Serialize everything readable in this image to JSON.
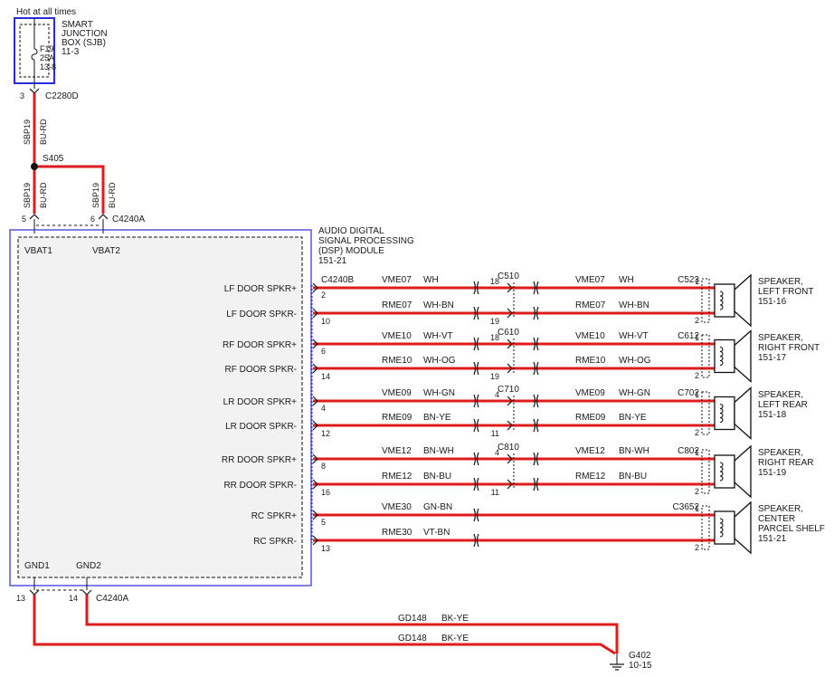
{
  "colors": {
    "wire": "#e01b1b",
    "module_border": "#2b2bd6",
    "module_fill": "#f2f2f2",
    "line": "#111111"
  },
  "power": {
    "hot_label": "Hot at all times",
    "sjb_title": [
      "SMART",
      "JUNCTION",
      "BOX (SJB)",
      "11-3"
    ],
    "fuse": [
      "F19",
      "25A",
      "13-8"
    ],
    "sjb_pin": "3",
    "sjb_connector": "C2280D"
  },
  "feed": {
    "circuit": "SBP19",
    "color_code": "BU-RD",
    "splice": "S405"
  },
  "module": {
    "title": [
      "AUDIO DIGITAL",
      "SIGNAL PROCESSING",
      "(DSP) MODULE",
      "151-21"
    ],
    "top_connector": "C4240A",
    "connector_b": "C4240B",
    "bottom_connector": "C4240A",
    "vbat": [
      {
        "label": "VBAT1",
        "pin": "5"
      },
      {
        "label": "VBAT2",
        "pin": "6"
      }
    ],
    "gnd": [
      {
        "label": "GND1",
        "pin": "13"
      },
      {
        "label": "GND2",
        "pin": "14"
      }
    ]
  },
  "channels": [
    {
      "connector": "C510",
      "spk_connector": "C523",
      "spk_title": [
        "SPEAKER,",
        "LEFT FRONT",
        "151-16"
      ],
      "pos": {
        "label": "LF DOOR SPKR+",
        "dsp_pin": "2",
        "circuit": "VME07",
        "color": "WH",
        "inline_pin": "18",
        "spk_pin": "1"
      },
      "neg": {
        "label": "LF DOOR SPKR-",
        "dsp_pin": "10",
        "circuit": "RME07",
        "color": "WH-BN",
        "inline_pin": "19",
        "spk_pin": "2"
      }
    },
    {
      "connector": "C610",
      "spk_connector": "C612",
      "spk_title": [
        "SPEAKER,",
        "RIGHT FRONT",
        "151-17"
      ],
      "pos": {
        "label": "RF DOOR SPKR+",
        "dsp_pin": "6",
        "circuit": "VME10",
        "color": "WH-VT",
        "inline_pin": "18",
        "spk_pin": "1"
      },
      "neg": {
        "label": "RF DOOR SPKR-",
        "dsp_pin": "14",
        "circuit": "RME10",
        "color": "WH-OG",
        "inline_pin": "19",
        "spk_pin": "2"
      }
    },
    {
      "connector": "C710",
      "spk_connector": "C702",
      "spk_title": [
        "SPEAKER,",
        "LEFT REAR",
        "151-18"
      ],
      "pos": {
        "label": "LR DOOR SPKR+",
        "dsp_pin": "4",
        "circuit": "VME09",
        "color": "WH-GN",
        "inline_pin": "4",
        "spk_pin": "1"
      },
      "neg": {
        "label": "LR DOOR SPKR-",
        "dsp_pin": "12",
        "circuit": "RME09",
        "color": "BN-YE",
        "inline_pin": "11",
        "spk_pin": "2"
      }
    },
    {
      "connector": "C810",
      "spk_connector": "C802",
      "spk_title": [
        "SPEAKER,",
        "RIGHT REAR",
        "151-19"
      ],
      "pos": {
        "label": "RR DOOR SPKR+",
        "dsp_pin": "8",
        "circuit": "VME12",
        "color": "BN-WH",
        "inline_pin": "4",
        "spk_pin": "1"
      },
      "neg": {
        "label": "RR DOOR SPKR-",
        "dsp_pin": "16",
        "circuit": "RME12",
        "color": "BN-BU",
        "inline_pin": "11",
        "spk_pin": "2"
      }
    },
    {
      "connector": "",
      "spk_connector": "C3652",
      "spk_title": [
        "SPEAKER,",
        "CENTER",
        "PARCEL SHELF",
        "151-21"
      ],
      "pos": {
        "label": "RC SPKR+",
        "dsp_pin": "5",
        "circuit": "VME30",
        "color": "GN-BN",
        "inline_pin": "",
        "spk_pin": "1"
      },
      "neg": {
        "label": "RC SPKR-",
        "dsp_pin": "13",
        "circuit": "RME30",
        "color": "VT-BN",
        "inline_pin": "",
        "spk_pin": "2"
      }
    }
  ],
  "ground": {
    "circuit": "GD148",
    "color_code": "BK-YE",
    "point": "G402",
    "point_ref": "10-15"
  }
}
